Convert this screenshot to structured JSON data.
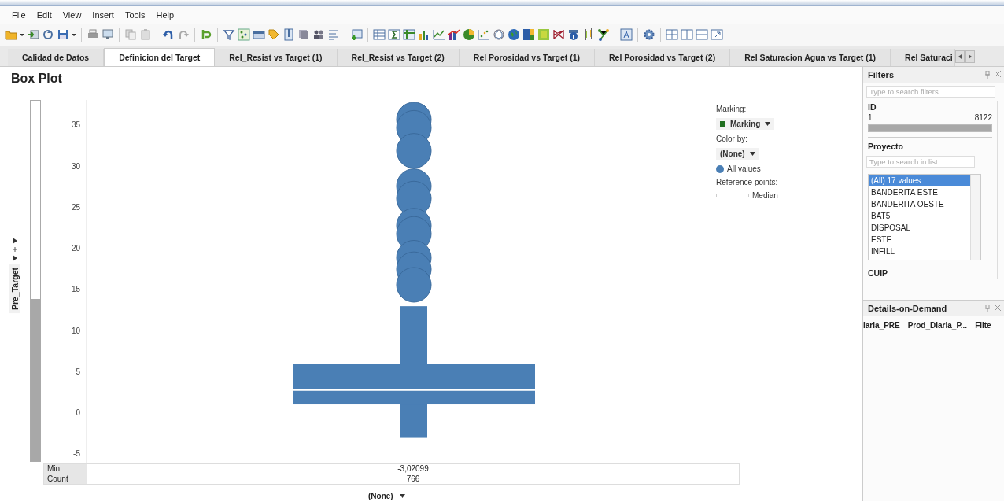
{
  "menu": [
    "File",
    "Edit",
    "View",
    "Insert",
    "Tools",
    "Help"
  ],
  "tabs": [
    {
      "label": "Calidad de Datos",
      "selected": false
    },
    {
      "label": "Definicion del Target",
      "selected": true
    },
    {
      "label": "Rel_Resist vs Target (1)",
      "selected": false
    },
    {
      "label": "Rel_Resist vs Target (2)",
      "selected": false
    },
    {
      "label": "Rel Porosidad vs Target (1)",
      "selected": false
    },
    {
      "label": "Rel Porosidad vs Target (2)",
      "selected": false
    },
    {
      "label": "Rel Saturacion Agua vs Target (1)",
      "selected": false
    },
    {
      "label": "Rel Saturaci",
      "selected": false
    }
  ],
  "visualization": {
    "title": "Box Plot",
    "y_axis_selector": "Pre_Target",
    "x_axis_selector": "(None)",
    "y_ticks": [
      "35",
      "30",
      "25",
      "20",
      "15",
      "10",
      "5",
      "0",
      "-5"
    ],
    "legend": {
      "marking_label": "Marking:",
      "marking_value": "Marking",
      "color_by_label": "Color by:",
      "color_by_value": "(None)",
      "series_label": "All values",
      "reference_label": "Reference points:",
      "reference_value": "Median"
    },
    "stats": [
      {
        "label": "Min",
        "value": "-3,02099"
      },
      {
        "label": "Count",
        "value": "766"
      }
    ]
  },
  "filters": {
    "title": "Filters",
    "search_placeholder": "Type to search filters",
    "id_filter": {
      "name": "ID",
      "min": "1",
      "max": "8122",
      "level": 1
    },
    "proyecto": {
      "name": "Proyecto",
      "search_placeholder": "Type to search in list",
      "items": [
        {
          "label": "(All) 17 values",
          "selected": true
        },
        {
          "label": "BANDERITA ESTE",
          "selected": false
        },
        {
          "label": "BANDERITA OESTE",
          "selected": false
        },
        {
          "label": "BAT5",
          "selected": false
        },
        {
          "label": "DISPOSAL",
          "selected": false
        },
        {
          "label": "ESTE",
          "selected": false
        },
        {
          "label": "INFILL",
          "selected": false
        }
      ]
    },
    "next_filter": "CUIP"
  },
  "details": {
    "title": "Details-on-Demand",
    "columns": [
      "iaria_PRE",
      "Prod_Diaria_P...",
      "Filte"
    ]
  }
}
